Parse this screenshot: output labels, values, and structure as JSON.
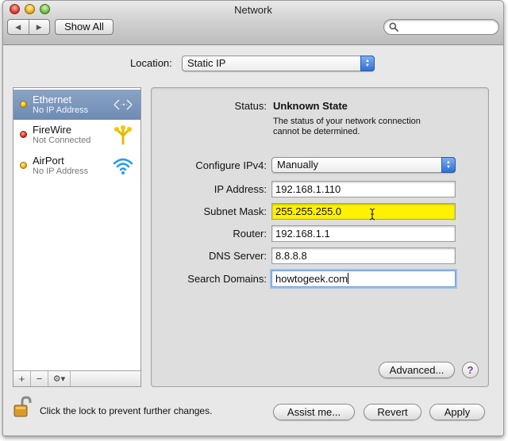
{
  "window": {
    "title": "Network",
    "show_all_label": "Show All",
    "nav_back": "◀",
    "nav_forward": "▶"
  },
  "search": {
    "placeholder": ""
  },
  "location": {
    "label": "Location:",
    "value": "Static IP"
  },
  "services": [
    {
      "name": "Ethernet",
      "status": "No IP Address",
      "indicator": "yellow",
      "icon": "ethernet-icon",
      "selected": true
    },
    {
      "name": "FireWire",
      "status": "Not Connected",
      "indicator": "red",
      "icon": "firewire-icon",
      "selected": false
    },
    {
      "name": "AirPort",
      "status": "No IP Address",
      "indicator": "yellow",
      "icon": "airport-wifi-icon",
      "selected": false
    }
  ],
  "sidebar_tools": {
    "add": "+",
    "remove": "−",
    "action": "⚙▾"
  },
  "detail": {
    "status_label": "Status:",
    "status_value": "Unknown State",
    "status_description": "The status of your network connection cannot be determined.",
    "configure_label": "Configure IPv4:",
    "configure_value": "Manually",
    "ip_label": "IP Address:",
    "ip_value": "192.168.1.110",
    "subnet_label": "Subnet Mask:",
    "subnet_value": "255.255.255.0",
    "router_label": "Router:",
    "router_value": "192.168.1.1",
    "dns_label": "DNS Server:",
    "dns_value": "8.8.8.8",
    "search_domains_label": "Search Domains:",
    "search_domains_value": "howtogeek.com",
    "advanced_label": "Advanced...",
    "help_label": "?"
  },
  "footer": {
    "lock_text": "Click the lock to prevent further changes.",
    "assist_label": "Assist me...",
    "revert_label": "Revert",
    "apply_label": "Apply"
  },
  "colors": {
    "selection": "#7b96bd",
    "highlight_field": "#fff200",
    "popup_arrow_blue": "#2d6fd6"
  }
}
